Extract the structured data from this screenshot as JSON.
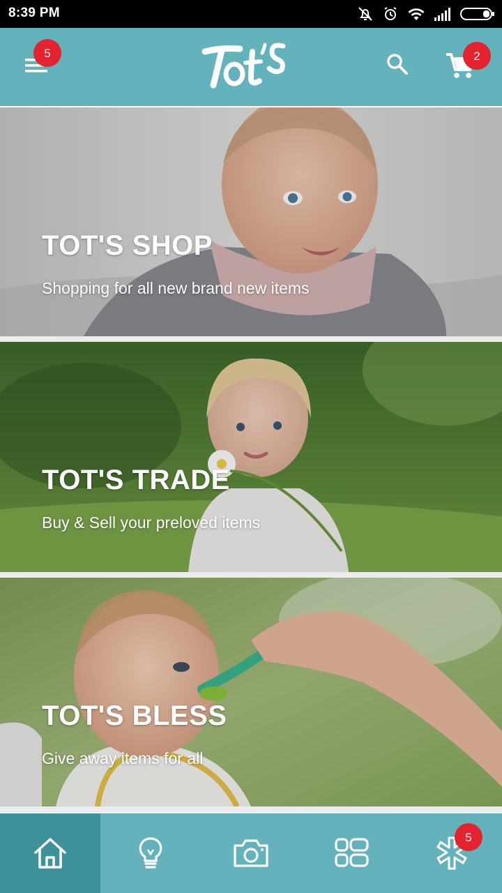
{
  "status_bar": {
    "time": "8:39 PM",
    "icons": [
      "mute-icon",
      "alarm-icon",
      "wifi-icon",
      "signal-icon",
      "battery-icon"
    ]
  },
  "header": {
    "logo_text": "Tot's",
    "menu_badge": "5",
    "cart_badge": "2",
    "background_color": "#63b2bc",
    "badge_color": "#e3232f",
    "icons": [
      "menu-icon",
      "search-icon",
      "cart-icon"
    ]
  },
  "banners": [
    {
      "title": "TOT'S SHOP",
      "subtitle": "Shopping for all new brand new items"
    },
    {
      "title": "TOT'S TRADE",
      "subtitle": "Buy & Sell your preloved items"
    },
    {
      "title": "TOT'S BLESS",
      "subtitle": "Give away items for all"
    }
  ],
  "bottom_nav": {
    "items": [
      "home-icon",
      "lightbulb-icon",
      "camera-icon",
      "grid-icon",
      "asterisk-icon"
    ],
    "active_index": 0,
    "badge": "5",
    "active_color": "#3f919b"
  }
}
